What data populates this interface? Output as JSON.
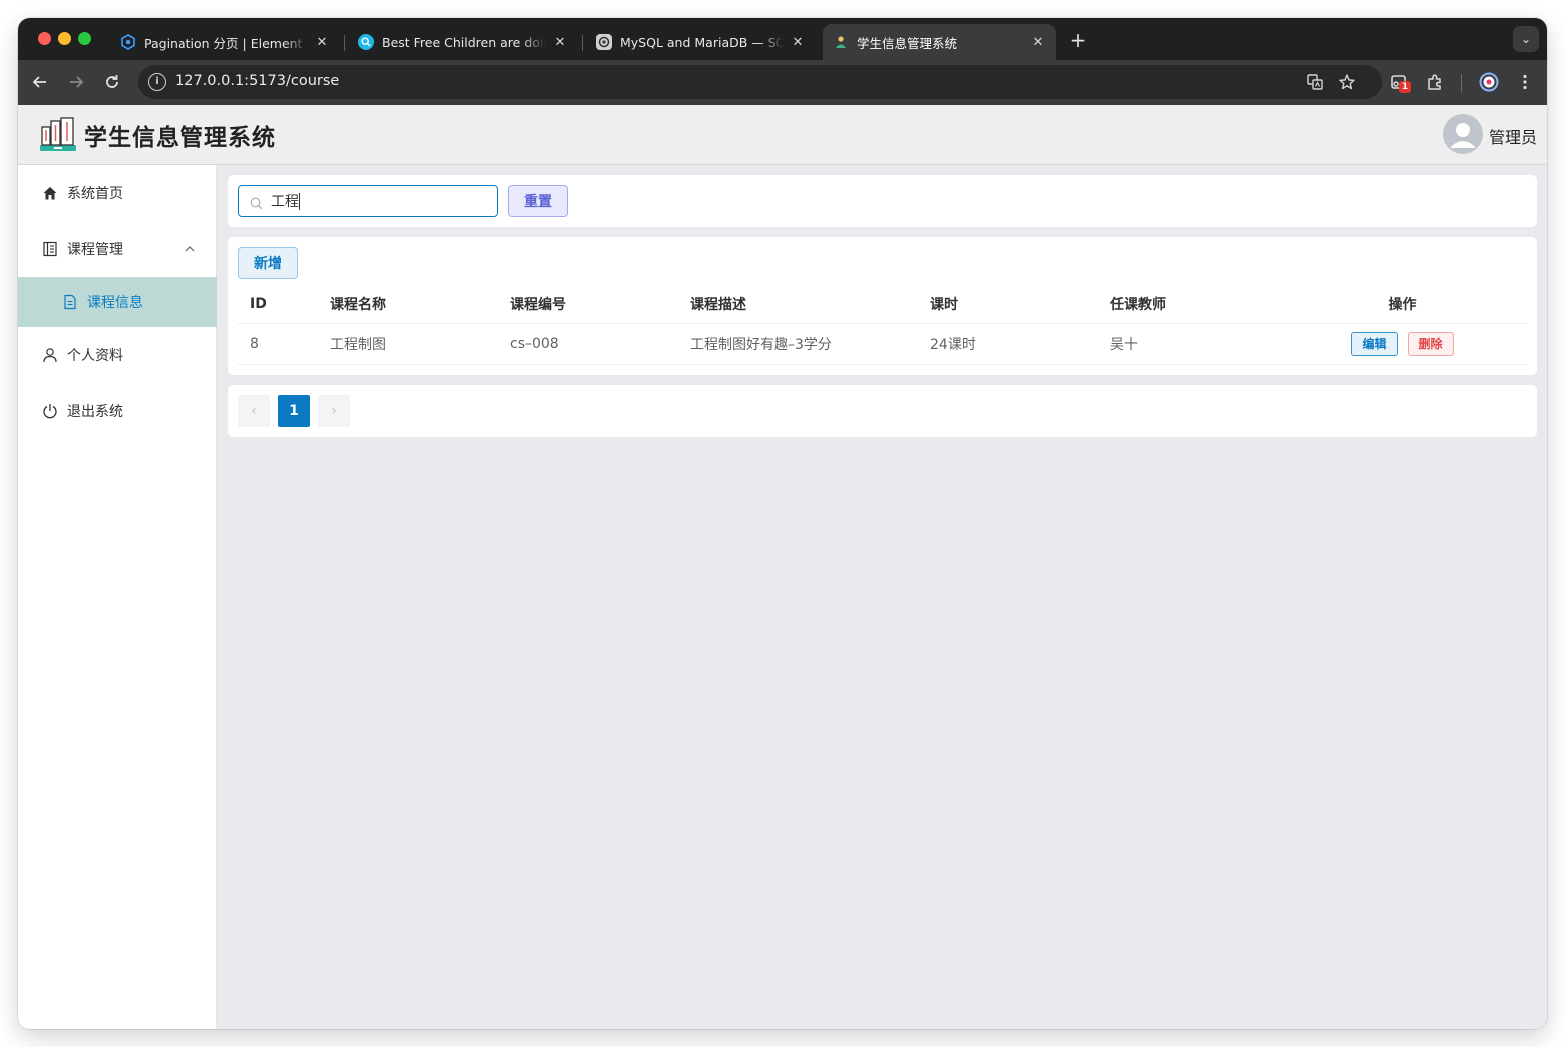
{
  "browser": {
    "tabs": [
      {
        "title": "Pagination 分页 | Element Plus",
        "favicon": "element-plus-logo",
        "active": false
      },
      {
        "title": "Best Free Children are doing ...",
        "favicon": "search-globe",
        "active": false
      },
      {
        "title": "MySQL and MariaDB — SQLAlchemy",
        "favicon": "sqlalchemy-logo",
        "active": false
      },
      {
        "title": "学生信息管理系统",
        "favicon": "student-icon",
        "active": true
      }
    ],
    "url": "127.0.0.1:5173/course",
    "extension_badge": "1"
  },
  "app": {
    "title": "学生信息管理系统",
    "user_name": "管理员"
  },
  "sidebar": {
    "items": [
      {
        "label": "系统首页",
        "icon": "home-icon"
      },
      {
        "label": "课程管理",
        "icon": "document-icon",
        "expanded": true
      },
      {
        "label": "课程信息",
        "icon": "file-icon",
        "active": true
      },
      {
        "label": "个人资料",
        "icon": "user-icon"
      },
      {
        "label": "退出系统",
        "icon": "power-icon"
      }
    ]
  },
  "search": {
    "value": "工程",
    "reset_label": "重置"
  },
  "toolbar": {
    "add_label": "新增"
  },
  "table": {
    "columns": [
      "ID",
      "课程名称",
      "课程编号",
      "课程描述",
      "课时",
      "任课教师",
      "操作"
    ],
    "rows": [
      {
        "id": "8",
        "name": "工程制图",
        "code": "cs–008",
        "desc": "工程制图好有趣–3学分",
        "hours": "24课时",
        "teacher": "吴十",
        "edit": "编辑",
        "delete": "删除"
      }
    ]
  },
  "pagination": {
    "current": "1",
    "prev": "‹",
    "next": "›"
  },
  "colors": {
    "primary": "#0a7bc2",
    "active_menu_bg": "#bdd9d5",
    "danger": "#e04646",
    "reset_accent": "#5a62d8"
  }
}
